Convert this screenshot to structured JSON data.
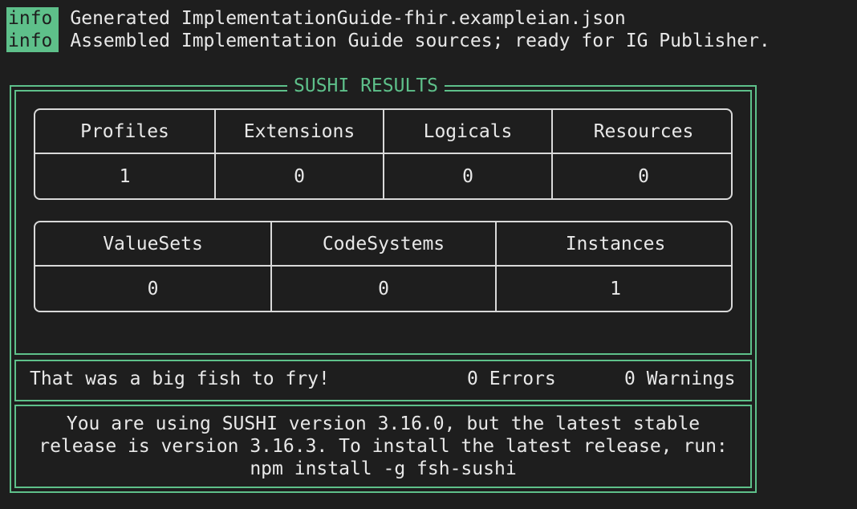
{
  "log": [
    {
      "tag": "info",
      "message": "Generated ImplementationGuide-fhir.exampleian.json"
    },
    {
      "tag": "info",
      "message": "Assembled Implementation Guide sources; ready for IG Publisher."
    }
  ],
  "results": {
    "title": "SUSHI RESULTS",
    "table1": {
      "headers": [
        "Profiles",
        "Extensions",
        "Logicals",
        "Resources"
      ],
      "values": [
        "1",
        "0",
        "0",
        "0"
      ]
    },
    "table2": {
      "headers": [
        "ValueSets",
        "CodeSystems",
        "Instances"
      ],
      "values": [
        "0",
        "0",
        "1"
      ]
    },
    "summary": {
      "message": "That was a big fish to fry!",
      "errors": "0 Errors",
      "warnings": "0 Warnings"
    },
    "update": {
      "line1": "You are using SUSHI version 3.16.0, but the latest stable",
      "line2": "release is version 3.16.3. To install the latest release, run:",
      "line3": "npm install -g fsh-sushi"
    }
  },
  "colors": {
    "accent": "#5ec08a",
    "background": "#1e1e1e",
    "text": "#e8e8e8"
  }
}
